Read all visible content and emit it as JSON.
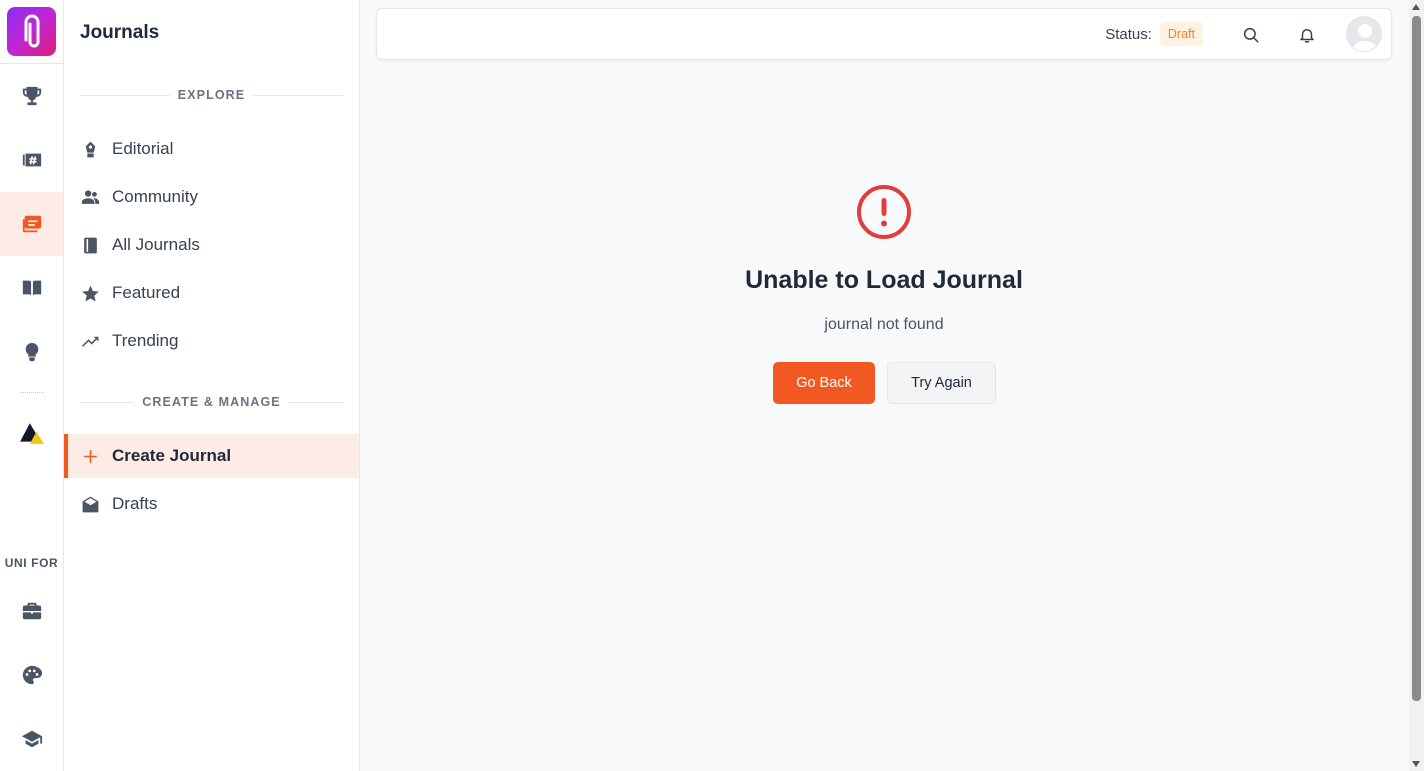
{
  "rail": {
    "section_label": "UNI FOR",
    "items": [
      {
        "icon": "trophy-icon",
        "active": false
      },
      {
        "icon": "hashtag-ticket-icon",
        "active": false
      },
      {
        "icon": "journal-cards-icon",
        "active": true
      },
      {
        "icon": "open-book-icon",
        "active": false
      },
      {
        "icon": "lightbulb-icon",
        "active": false
      },
      {
        "icon": "triangle-logo-icon",
        "active": false
      },
      {
        "icon": "briefcase-icon",
        "active": false
      },
      {
        "icon": "palette-icon",
        "active": false
      },
      {
        "icon": "graduation-cap-icon",
        "active": false
      }
    ]
  },
  "panel": {
    "title": "Journals",
    "explore_label": "EXPLORE",
    "explore_items": [
      {
        "label": "Editorial",
        "icon": "pen-nib-icon"
      },
      {
        "label": "Community",
        "icon": "users-icon"
      },
      {
        "label": "All Journals",
        "icon": "book-icon"
      },
      {
        "label": "Featured",
        "icon": "star-icon"
      },
      {
        "label": "Trending",
        "icon": "trending-up-icon"
      }
    ],
    "manage_label": "CREATE & MANAGE",
    "manage_items": [
      {
        "label": "Create Journal",
        "icon": "plus-icon",
        "active": true
      },
      {
        "label": "Drafts",
        "icon": "envelope-open-icon",
        "active": false
      }
    ]
  },
  "header": {
    "status_label": "Status:",
    "status_value": "Draft"
  },
  "error": {
    "title": "Unable to Load Journal",
    "message": "journal not found",
    "primary_button": "Go Back",
    "secondary_button": "Try Again"
  },
  "colors": {
    "accent": "#f05a22",
    "error": "#e03e3e",
    "draft_badge_bg": "#fef3e2",
    "draft_badge_text": "#e8872a"
  }
}
